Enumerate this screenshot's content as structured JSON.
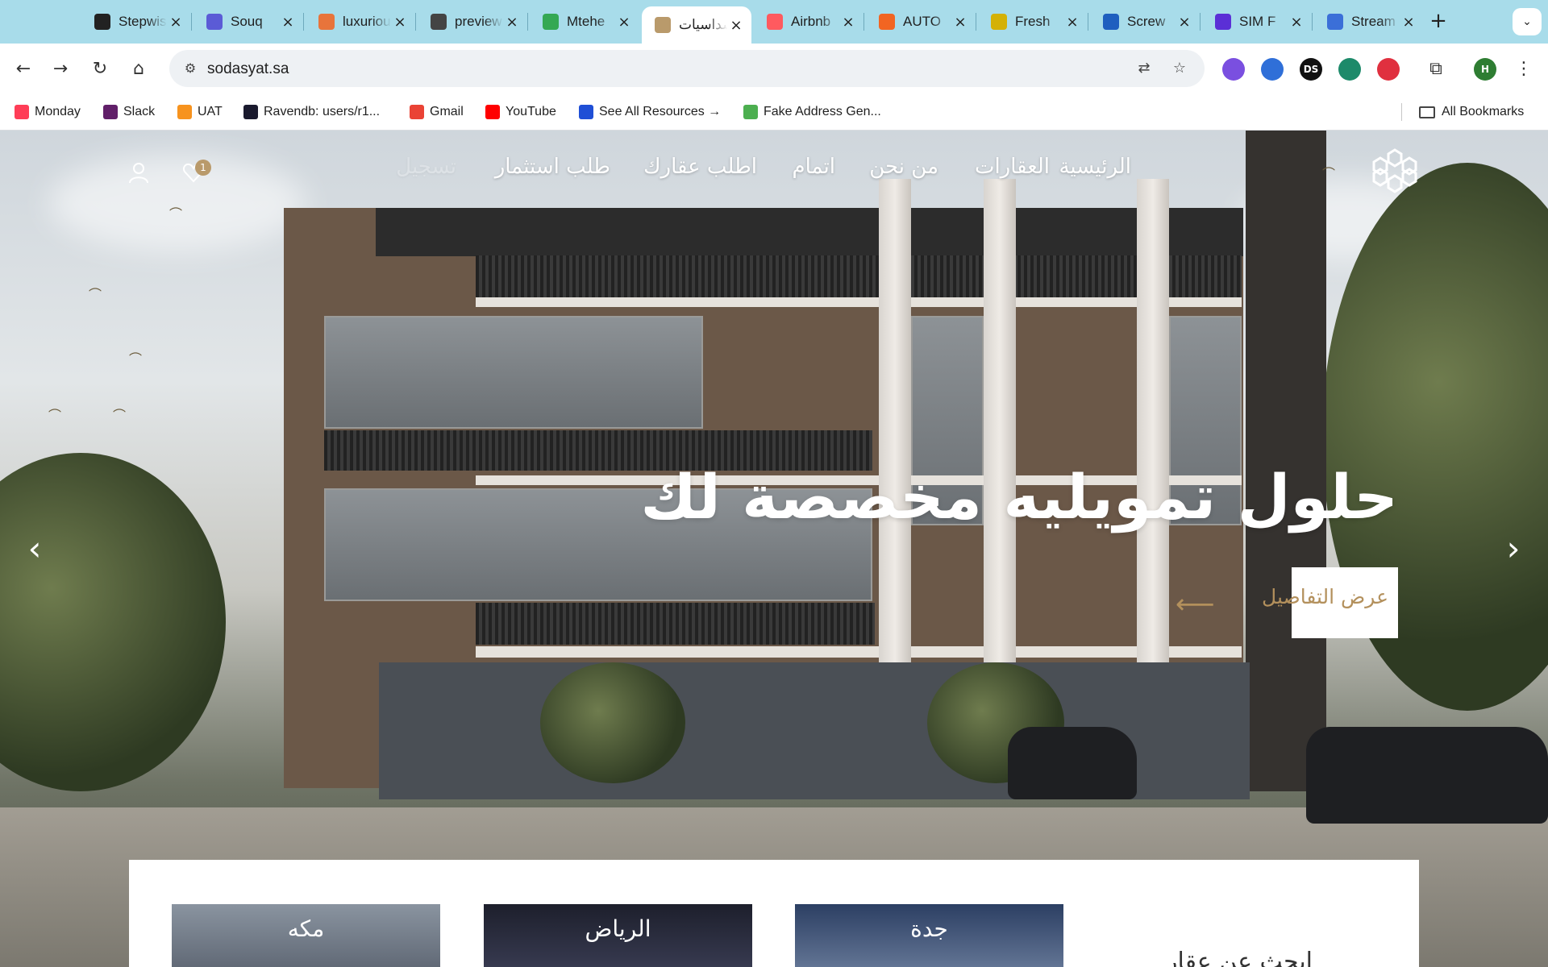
{
  "tabs": [
    {
      "title": "Stepwise",
      "icon": "openai-icon",
      "color": "#222222"
    },
    {
      "title": "Souq",
      "icon": "souq-icon",
      "color": "#5b5bd6"
    },
    {
      "title": "luxurious",
      "icon": "heart-icon",
      "color": "#e8743b"
    },
    {
      "title": "preview",
      "icon": "buildings-icon",
      "color": "#444444"
    },
    {
      "title": "Mtehe",
      "icon": "maps-pin-icon",
      "color": "#34a853"
    },
    {
      "title": "سداسيات",
      "icon": "hexagon-flower-icon",
      "color": "#b99a6b",
      "active": true
    },
    {
      "title": "Airbnb",
      "icon": "airbnb-icon",
      "color": "#ff5a5f"
    },
    {
      "title": "AUTO",
      "icon": "plus-cross-icon",
      "color": "#f26522"
    },
    {
      "title": "Fresh",
      "icon": "ticket-icon",
      "color": "#d4b106"
    },
    {
      "title": "Screw",
      "icon": "sf-icon",
      "color": "#1f5fbf"
    },
    {
      "title": "SIM F",
      "icon": "c-icon",
      "color": "#5b2fd6"
    },
    {
      "title": "Stream",
      "icon": "stream-icon",
      "color": "#3b6fd8"
    }
  ],
  "toolbar": {
    "url": "sodasyat.sa",
    "extensions": [
      {
        "name": "color-wheel-extension-icon",
        "label": "",
        "color": "#7a4fe0"
      },
      {
        "name": "shield-extension-icon",
        "label": "",
        "color": "#2f6fd8"
      },
      {
        "name": "ds-extension-icon",
        "label": "DS",
        "color": "#111111"
      },
      {
        "name": "monitor-extension-icon",
        "label": "",
        "color": "#1d8a6a"
      },
      {
        "name": "red-extension-icon",
        "label": "",
        "color": "#e0303f"
      }
    ],
    "profile_initial": "H"
  },
  "bookmarks": [
    {
      "label": "Monday",
      "icon": "monday-icon",
      "color": "#ff3d57"
    },
    {
      "label": "Slack",
      "icon": "slack-icon",
      "color": "#611f69"
    },
    {
      "label": "UAT",
      "icon": "uat-icon",
      "color": "#f7931e"
    },
    {
      "label": "Ravendb: users/r1...",
      "icon": "ravendb-icon",
      "color": "#1a1a2e"
    },
    {
      "label": "Gmail",
      "icon": "gmail-icon",
      "color": "#ea4335"
    },
    {
      "label": "YouTube",
      "icon": "youtube-icon",
      "color": "#ff0000"
    },
    {
      "label": "See All Resources →",
      "icon": "resources-icon",
      "color": "#1f4fd6"
    },
    {
      "label": "Fake Address Gen...",
      "icon": "map-marker-icon",
      "color": "#4caf50"
    }
  ],
  "all_bookmarks": "All Bookmarks",
  "site": {
    "nav": [
      "الرئيسية",
      "العقارات",
      "من نحن",
      "اتمام",
      "اطلب عقارك",
      "طلب استثمار",
      "تسجيل"
    ],
    "wishlist_count": "1",
    "hero": {
      "headline": "حلول تمويليه مخصصة لك",
      "cta_label": "عرض التفاصيل"
    },
    "search_title": "ابحث عن عقار",
    "cities": [
      "جدة",
      "الرياض",
      "مكه"
    ],
    "accent": "#b3905c"
  }
}
